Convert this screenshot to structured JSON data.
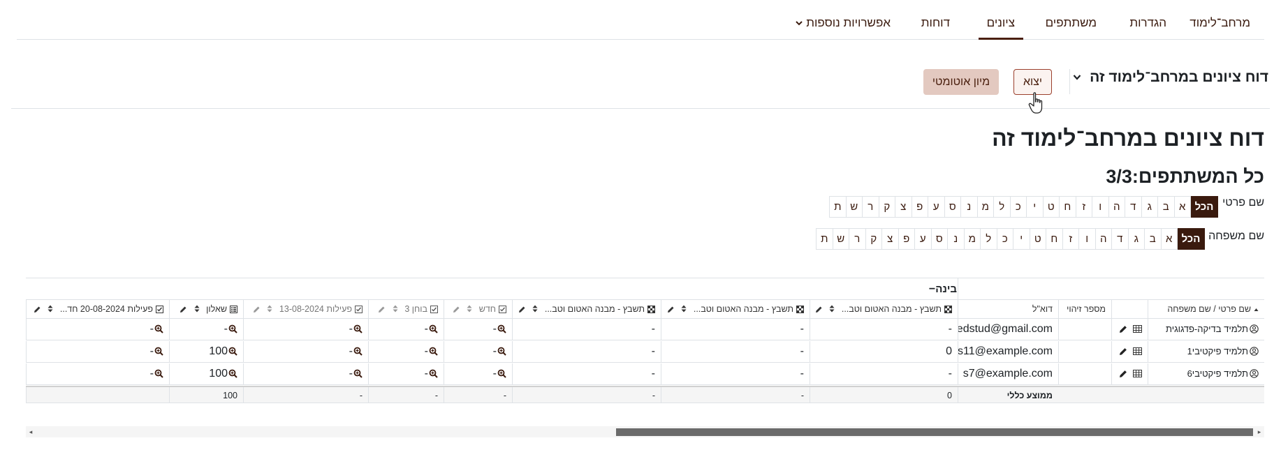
{
  "nav": {
    "tabs": [
      {
        "label": "מרחב־לימוד",
        "active": false
      },
      {
        "label": "הגדרות",
        "active": false
      },
      {
        "label": "משתתפים",
        "active": false
      },
      {
        "label": "ציונים",
        "active": true
      },
      {
        "label": "דוחות",
        "active": false
      },
      {
        "label": "אפשרויות נוספות",
        "active": false
      }
    ]
  },
  "actionbar": {
    "report_select": "דוח ציונים במרחב־לימוד זה",
    "export_label": "יצוא",
    "autosort_label": "מיון אוטומטי"
  },
  "page": {
    "title": "דוח ציונים במרחב־לימוד זה",
    "participants": "כל המשתתפים:3/3"
  },
  "filters": {
    "firstname_label": "שם פרטי",
    "lastname_label": "שם משפחה",
    "all_label": "הכל",
    "letters": [
      "א",
      "ב",
      "ג",
      "ד",
      "ה",
      "ו",
      "ז",
      "ח",
      "ט",
      "י",
      "כ",
      "ל",
      "מ",
      "נ",
      "ס",
      "ע",
      "פ",
      "צ",
      "ק",
      "ר",
      "ש",
      "ת"
    ]
  },
  "table": {
    "category": "בינה",
    "headers": {
      "name": "שם פרטי / שם משפחה",
      "id": "מספר זיהוי",
      "email": "דוא\"ל",
      "item1": "תשבץ - מבנה האטום וטב...",
      "item2": "תשבץ - מבנה האטום וטב...",
      "item3": "תשבץ - מבנה האטום וטב...",
      "item4": "חדש",
      "item5": "בוחן 3",
      "item6": "פעילות 13-08-2024",
      "item7": "שאלון",
      "item8": "פעילות 20-08-2024 חד..."
    },
    "rows": [
      {
        "name": "תלמיד בדיקה-פדגוגית",
        "email": "pedstud@gmail.com",
        "item1": "-",
        "item2": "-",
        "item3": "-",
        "item4": "-",
        "item5": "-",
        "item6": "-",
        "item7": "-",
        "item8": "-"
      },
      {
        "name": "תלמיד פיקטיבי1",
        "email": "s11@example.com",
        "item1": "0",
        "item2": "-",
        "item3": "-",
        "item4": "-",
        "item5": "-",
        "item6": "-",
        "item7": "100",
        "item8": "-"
      },
      {
        "name": "תלמיד פיקטיבי6",
        "email": "s7@example.com",
        "item1": "-",
        "item2": "-",
        "item3": "-",
        "item4": "-",
        "item5": "-",
        "item6": "-",
        "item7": "100",
        "item8": "-"
      }
    ],
    "average": {
      "label": "ממוצע כללי",
      "item1": "0",
      "item2": "-",
      "item3": "-",
      "item4": "-",
      "item5": "-",
      "item6": "-",
      "item7": "100",
      "item8": ""
    }
  },
  "colors": {
    "brand": "#4a1f0e",
    "accent_bg": "#e3c9c0"
  }
}
